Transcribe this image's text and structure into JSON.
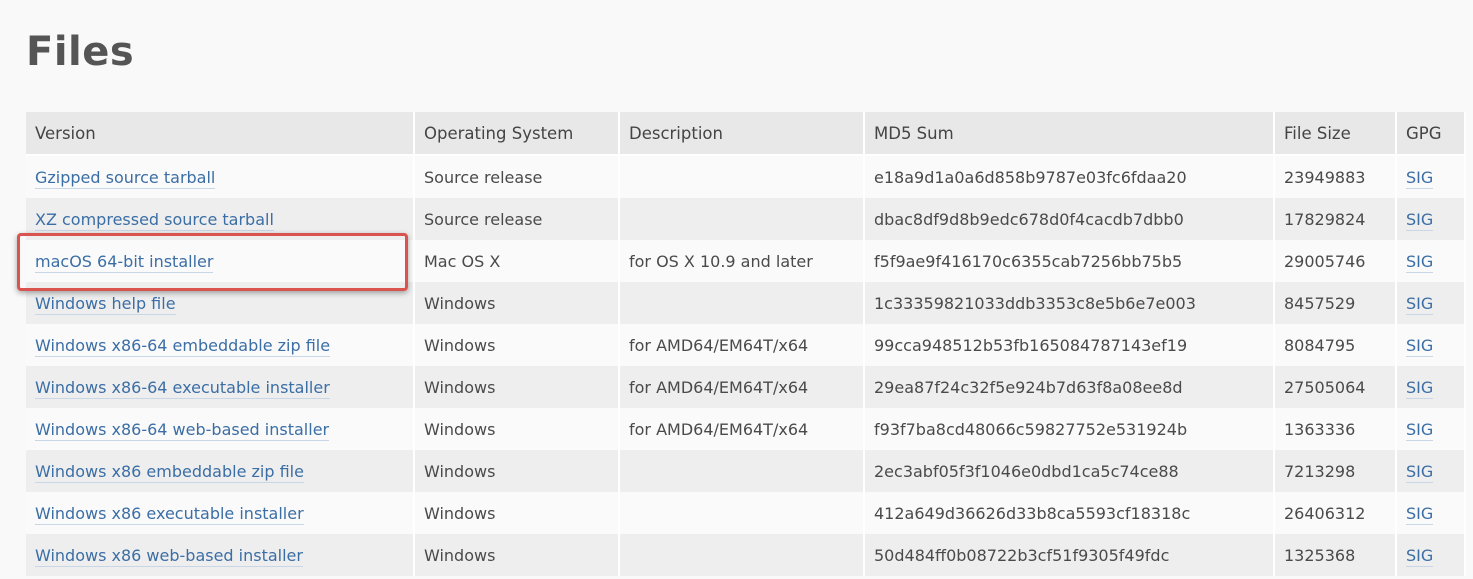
{
  "page": {
    "title": "Files"
  },
  "table": {
    "headers": [
      "Version",
      "Operating System",
      "Description",
      "MD5 Sum",
      "File Size",
      "GPG"
    ],
    "rows": [
      {
        "version": "Gzipped source tarball",
        "os": "Source release",
        "description": "",
        "md5": "e18a9d1a0a6d858b9787e03fc6fdaa20",
        "size": "23949883",
        "gpg": "SIG"
      },
      {
        "version": "XZ compressed source tarball",
        "os": "Source release",
        "description": "",
        "md5": "dbac8df9d8b9edc678d0f4cacdb7dbb0",
        "size": "17829824",
        "gpg": "SIG"
      },
      {
        "version": "macOS 64-bit installer",
        "os": "Mac OS X",
        "description": "for OS X 10.9 and later",
        "md5": "f5f9ae9f416170c6355cab7256bb75b5",
        "size": "29005746",
        "gpg": "SIG"
      },
      {
        "version": "Windows help file",
        "os": "Windows",
        "description": "",
        "md5": "1c33359821033ddb3353c8e5b6e7e003",
        "size": "8457529",
        "gpg": "SIG"
      },
      {
        "version": "Windows x86-64 embeddable zip file",
        "os": "Windows",
        "description": "for AMD64/EM64T/x64",
        "md5": "99cca948512b53fb165084787143ef19",
        "size": "8084795",
        "gpg": "SIG"
      },
      {
        "version": "Windows x86-64 executable installer",
        "os": "Windows",
        "description": "for AMD64/EM64T/x64",
        "md5": "29ea87f24c32f5e924b7d63f8a08ee8d",
        "size": "27505064",
        "gpg": "SIG"
      },
      {
        "version": "Windows x86-64 web-based installer",
        "os": "Windows",
        "description": "for AMD64/EM64T/x64",
        "md5": "f93f7ba8cd48066c59827752e531924b",
        "size": "1363336",
        "gpg": "SIG"
      },
      {
        "version": "Windows x86 embeddable zip file",
        "os": "Windows",
        "description": "",
        "md5": "2ec3abf05f3f1046e0dbd1ca5c74ce88",
        "size": "7213298",
        "gpg": "SIG"
      },
      {
        "version": "Windows x86 executable installer",
        "os": "Windows",
        "description": "",
        "md5": "412a649d36626d33b8ca5593cf18318c",
        "size": "26406312",
        "gpg": "SIG"
      },
      {
        "version": "Windows x86 web-based installer",
        "os": "Windows",
        "description": "",
        "md5": "50d484ff0b08722b3cf51f9305f49fdc",
        "size": "1325368",
        "gpg": "SIG"
      }
    ]
  },
  "colors": {
    "link": "#3b6ea5",
    "highlight": "#d9534f",
    "header_bg": "#e8e8e8"
  }
}
